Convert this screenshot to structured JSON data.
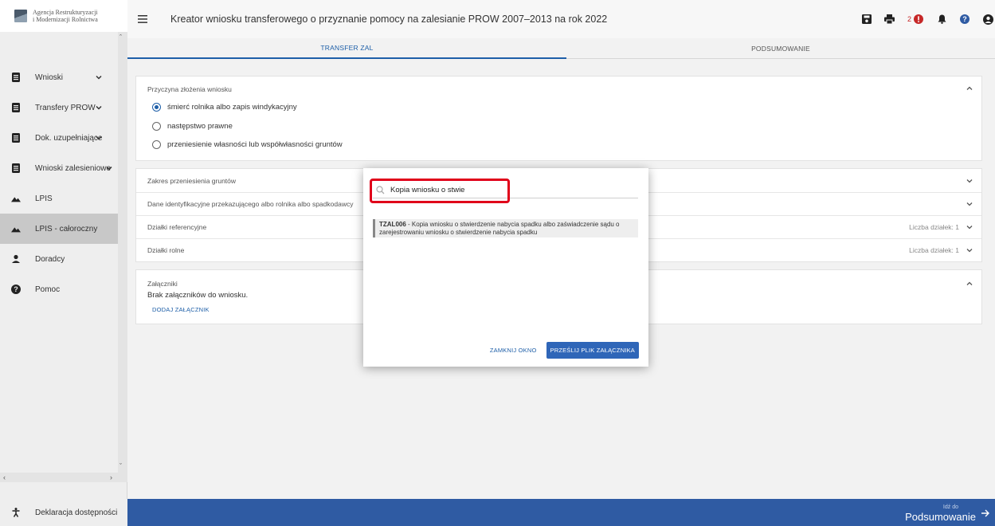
{
  "logo": {
    "line1": "Agencja Restrukturyzacji",
    "line2": "i Modernizacji Rolnictwa"
  },
  "header": {
    "title": "Kreator wniosku transferowego o przyznanie pomocy na zalesianie PROW 2007–2013 na rok 2022",
    "alert_count": "2"
  },
  "sidebar": {
    "items": [
      {
        "label": "Wnioski",
        "icon": "document-icon"
      },
      {
        "label": "Transfery PROW",
        "icon": "document-icon"
      },
      {
        "label": "Dok. uzupełniające",
        "icon": "document-icon"
      },
      {
        "label": "Wnioski zalesieniowe",
        "icon": "document-icon"
      },
      {
        "label": "LPIS",
        "icon": "mountain-icon"
      },
      {
        "label": "LPIS - całoroczny",
        "icon": "mountain-icon"
      },
      {
        "label": "Doradcy",
        "icon": "person-icon"
      },
      {
        "label": "Pomoc",
        "icon": "help-icon"
      }
    ],
    "footer": "Deklaracja dostępności"
  },
  "tabs": [
    {
      "label": "TRANSFER ZAL"
    },
    {
      "label": "PODSUMOWANIE"
    }
  ],
  "reason": {
    "label": "Przyczyna złożenia wniosku",
    "options": [
      {
        "label": "śmierć rolnika albo zapis windykacyjny",
        "selected": true
      },
      {
        "label": "następstwo prawne",
        "selected": false
      },
      {
        "label": "przeniesienie własności lub współwłasności gruntów",
        "selected": false
      }
    ]
  },
  "sections": {
    "scope": "Zakres przeniesienia gruntów",
    "ident": "Dane identyfikacyjne przekazującego albo rolnika albo spadkodawcy",
    "ref": "Działki referencyjne",
    "ref_count": "Liczba działek: 1",
    "agri": "Działki rolne",
    "agri_count": "Liczba działek: 1"
  },
  "attachments": {
    "label": "Załączniki",
    "empty": "Brak załączników do wniosku.",
    "add": "DODAJ ZAŁĄCZNIK"
  },
  "modal": {
    "search_value": "Kopia wniosku o stwie",
    "result_code": "TZAL006",
    "result_text": " - Kopia wniosku o stwierdzenie nabycia spadku albo zaświadczenie sądu o zarejestrowaniu wniosku o stwierdzenie nabycia spadku",
    "close": "ZAMKNIJ OKNO",
    "submit": "PRZEŚLIJ PLIK ZAŁĄCZNIKA"
  },
  "bottom": {
    "small": "Idź do",
    "big": "Podsumowanie"
  },
  "colors": {
    "accent": "#2f5ba3",
    "highlight": "#e0001a",
    "alert": "#c62828"
  }
}
